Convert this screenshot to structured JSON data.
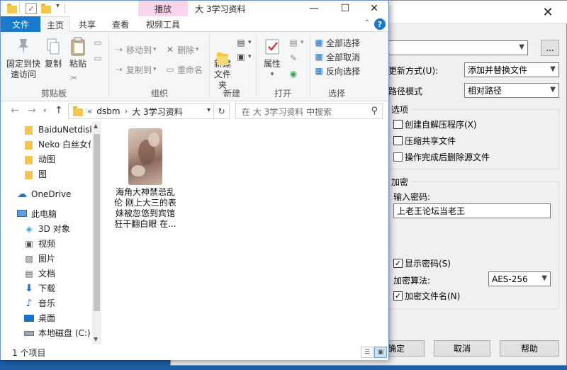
{
  "dialog": {
    "close_glyph": "✕",
    "browse_label": "...",
    "update_mode_label": "更新方式(U):",
    "update_mode_value": "添加并替换文件",
    "path_mode_label": "路径模式",
    "path_mode_value": "相对路径",
    "options_title": "选项",
    "opt_sfx": "创建自解压程序(X)",
    "opt_shared": "压缩共享文件",
    "opt_delete": "操作完成后删除源文件",
    "encrypt_title": "加密",
    "password_label": "输入密码:",
    "password_value": "上老王论坛当老王",
    "show_password": "显示密码(S)",
    "algorithm_label": "加密算法:",
    "algorithm_value": "AES-256",
    "encrypt_names": "加密文件名(N)",
    "ok_label": "确定",
    "cancel_label": "取消",
    "help_label": "帮助"
  },
  "explorer": {
    "context_tab": "播放",
    "title": "大 3学习资料",
    "tabs": [
      "文件",
      "主页",
      "共享",
      "查看",
      "视频工具"
    ],
    "clipboard": {
      "pin": "固定到快速访问",
      "copy": "复制",
      "paste": "粘贴",
      "label": "剪贴板"
    },
    "organize": {
      "move_to": "移动到",
      "copy_to": "复制到",
      "delete": "删除",
      "rename": "重命名",
      "label": "组织"
    },
    "new_group": {
      "new_folder": "新建\n文件夹",
      "label": "新建"
    },
    "open_group": {
      "properties": "属性",
      "label": "打开"
    },
    "select_group": {
      "select_all": "全部选择",
      "select_none": "全部取消",
      "invert": "反向选择",
      "label": "选择"
    },
    "address": [
      "dsbm",
      "大 3学习资料"
    ],
    "search_placeholder": "在 大 3学习资料 中搜索",
    "nav_items": [
      "BaiduNetdiskD",
      "Neko 白丝女仆",
      "动图",
      "图",
      "OneDrive",
      "此电脑",
      "3D 对象",
      "视频",
      "图片",
      "文档",
      "下载",
      "音乐",
      "桌面",
      "本地磁盘 (C:)"
    ],
    "file_name": "海角大神禁忌乱伦 刚上大三的表妹被忽悠到宾馆 狂干翻白眼 在...",
    "status": "1 个项目"
  }
}
